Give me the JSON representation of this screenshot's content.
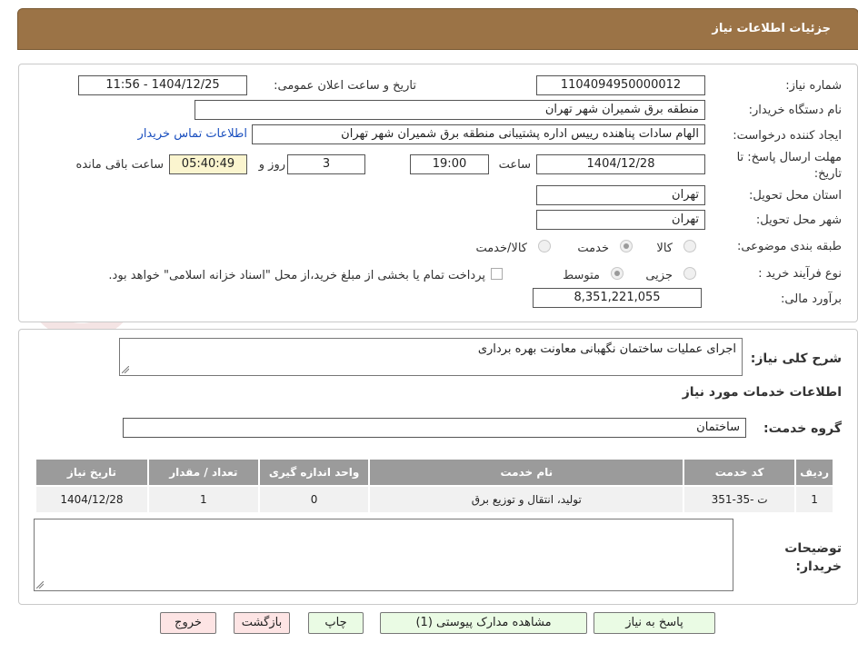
{
  "header": {
    "title": "جزئیات اطلاعات نیاز"
  },
  "form": {
    "need_number_label": "شماره نیاز:",
    "need_number": "1104094950000012",
    "announce_label": "تاریخ و ساعت اعلان عمومی:",
    "announce_value": "1404/12/25 - 11:56",
    "buyer_org_label": "نام دستگاه خریدار:",
    "buyer_org": "منطقه برق شمیران شهر تهران",
    "requester_label": "ایجاد کننده درخواست:",
    "requester": "الهام سادات پناهنده رییس اداره پشتیبانی منطقه برق شمیران شهر تهران",
    "contact_link": "اطلاعات تماس خریدار",
    "deadline_label": "مهلت ارسال پاسخ: تا تاریخ:",
    "deadline_date": "1404/12/28",
    "time_label": "ساعت",
    "deadline_time": "19:00",
    "days_value": "3",
    "days_label": "روز و",
    "remaining_time": "05:40:49",
    "remaining_label": "ساعت باقی مانده",
    "province_label": "استان محل تحویل:",
    "province": "تهران",
    "city_label": "شهر محل تحویل:",
    "city": "تهران",
    "category_label": "طبقه بندی موضوعی:",
    "category_options": [
      "کالا",
      "خدمت",
      "کالا/خدمت"
    ],
    "category_selected": "خدمت",
    "process_label": "نوع فرآیند خرید :",
    "process_options": [
      "جزیی",
      "متوسط"
    ],
    "process_selected": "متوسط",
    "payment_note": "پرداخت تمام یا بخشی از مبلغ خرید،از محل \"اسناد خزانه اسلامی\" خواهد بود.",
    "budget_label": "برآورد مالی:",
    "budget": "8,351,221,055"
  },
  "description": {
    "label": "شرح کلی نیاز:",
    "text": "اجرای عملیات ساختمان نگهبانی معاونت بهره برداری"
  },
  "services": {
    "section_title": "اطلاعات خدمات مورد نیاز",
    "group_label": "گروه خدمت:",
    "group_value": "ساختمان",
    "columns": [
      "ردیف",
      "کد خدمت",
      "نام خدمت",
      "واحد اندازه گیری",
      "تعداد / مقدار",
      "تاریخ نیاز"
    ],
    "rows": [
      [
        "1",
        "ت -35-351",
        "تولید، انتقال و توزیع برق",
        "0",
        "1",
        "1404/12/28"
      ]
    ]
  },
  "buyer_notes": {
    "label": "توضیحات خریدار:",
    "text": ""
  },
  "buttons": {
    "reply": "پاسخ به نیاز",
    "attachments": "مشاهده مدارک پیوستی (1)",
    "print": "چاپ",
    "back": "بازگشت",
    "exit": "خروج"
  },
  "colors": {
    "header": "#9b7346",
    "table_header": "#9b9b9b",
    "remaining_bg": "#fbf5cf",
    "green_button": "#eafbe4",
    "red_button": "#fde4e4"
  }
}
